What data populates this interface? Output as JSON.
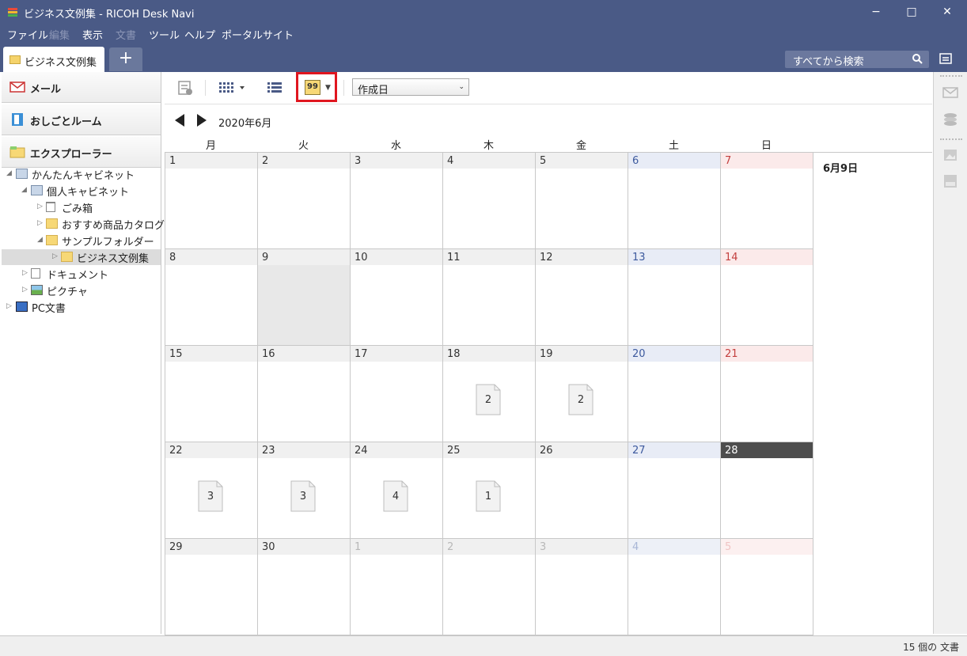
{
  "window": {
    "title": "ビジネス文例集 - RICOH Desk Navi",
    "minimize": "−",
    "maximize": "□",
    "close": "✕"
  },
  "menu": {
    "file": "ファイル",
    "edit": "編集",
    "view": "表示",
    "document": "文書",
    "tools": "ツール",
    "help": "ヘルプ",
    "portal": "ポータルサイト"
  },
  "tabs": {
    "active_label": "ビジネス文例集",
    "add_label": "+"
  },
  "search": {
    "placeholder": "すべてから検索"
  },
  "sidebar": {
    "mail": "メール",
    "work_room": "おしごとルーム",
    "explorer": "エクスプローラー",
    "tree": [
      "かんたんキャビネット",
      "個人キャビネット",
      "ごみ箱",
      "おすすめ商品カタログ集",
      "サンプルフォルダー",
      "ビジネス文例集",
      "ドキュメント",
      "ピクチャ",
      "PC文書"
    ]
  },
  "toolbar": {
    "calendar_icon_text": "99",
    "sort_value": "作成日"
  },
  "calendar": {
    "month_label": "2020年6月",
    "weekdays": [
      "月",
      "火",
      "水",
      "木",
      "金",
      "土",
      "日"
    ],
    "selected_day_label": "6月9日",
    "weeks": [
      [
        {
          "d": "1"
        },
        {
          "d": "2"
        },
        {
          "d": "3"
        },
        {
          "d": "4"
        },
        {
          "d": "5"
        },
        {
          "d": "6"
        },
        {
          "d": "7"
        }
      ],
      [
        {
          "d": "8"
        },
        {
          "d": "9",
          "selected": true
        },
        {
          "d": "10"
        },
        {
          "d": "11"
        },
        {
          "d": "12"
        },
        {
          "d": "13"
        },
        {
          "d": "14"
        }
      ],
      [
        {
          "d": "15"
        },
        {
          "d": "16"
        },
        {
          "d": "17"
        },
        {
          "d": "18",
          "docs": "2"
        },
        {
          "d": "19",
          "docs": "2"
        },
        {
          "d": "20"
        },
        {
          "d": "21"
        }
      ],
      [
        {
          "d": "22",
          "docs": "3"
        },
        {
          "d": "23",
          "docs": "3"
        },
        {
          "d": "24",
          "docs": "4"
        },
        {
          "d": "25",
          "docs": "1"
        },
        {
          "d": "26"
        },
        {
          "d": "27"
        },
        {
          "d": "28",
          "today": true
        }
      ],
      [
        {
          "d": "29"
        },
        {
          "d": "30"
        },
        {
          "d": "1",
          "other": true
        },
        {
          "d": "2",
          "other": true
        },
        {
          "d": "3",
          "other": true
        },
        {
          "d": "4",
          "other": true
        },
        {
          "d": "5",
          "other": true
        }
      ]
    ]
  },
  "status": {
    "count_text": "15 個の 文書"
  }
}
